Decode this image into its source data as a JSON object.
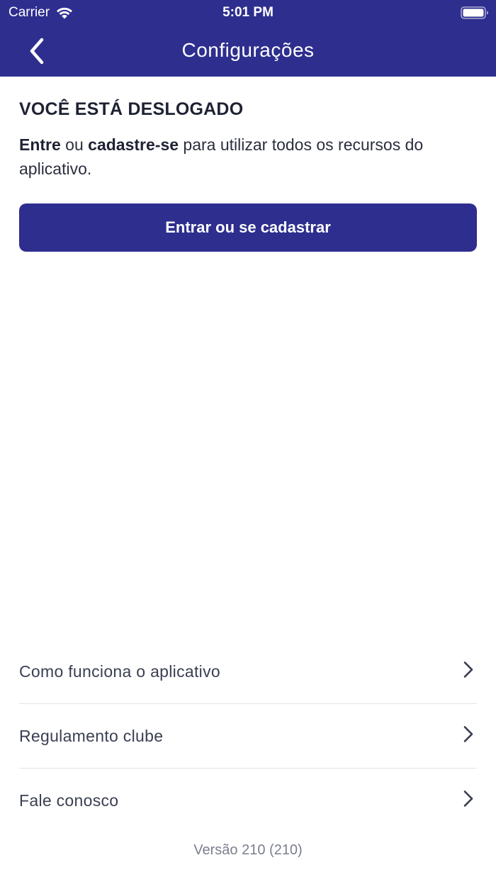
{
  "status_bar": {
    "carrier": "Carrier",
    "time": "5:01 PM"
  },
  "nav": {
    "title": "Configurações",
    "back_icon": "chevron-left-icon"
  },
  "logged_out": {
    "title": "VOCÊ ESTÁ DESLOGADO",
    "desc_enter": "Entre",
    "desc_or": " ou ",
    "desc_register": "cadastre-se",
    "desc_rest": " para utilizar todos os recursos do aplicativo.",
    "button_label": "Entrar ou se cadastrar"
  },
  "menu": {
    "items": [
      {
        "label": "Como funciona o aplicativo",
        "icon": "chevron-right-icon"
      },
      {
        "label": "Regulamento clube",
        "icon": "chevron-right-icon"
      },
      {
        "label": "Fale conosco",
        "icon": "chevron-right-icon"
      }
    ]
  },
  "footer": {
    "version": "Versão 210 (210)"
  },
  "colors": {
    "primary": "#2e2e8f",
    "text_dark": "#1f2233",
    "text_muted": "#7a7f8e",
    "divider": "#e3e4e8"
  }
}
